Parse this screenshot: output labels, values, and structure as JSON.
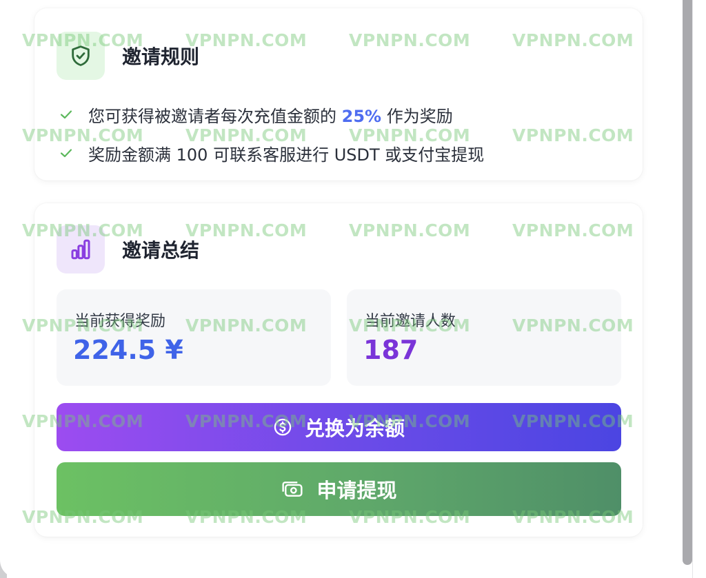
{
  "rules": {
    "title": "邀请规则",
    "items": [
      {
        "before": "您可获得被邀请者每次充值金额的 ",
        "highlight": "25%",
        "after": " 作为奖励"
      },
      {
        "before": "奖励金额满 100 可联系客服进行 USDT 或支付宝提现",
        "highlight": "",
        "after": ""
      }
    ]
  },
  "summary": {
    "title": "邀请总结",
    "reward_label": "当前获得奖励",
    "reward_value": "224.5 ¥",
    "invites_label": "当前邀请人数",
    "invites_value": "187"
  },
  "buttons": {
    "exchange_label": "兑换为余额",
    "withdraw_label": "申请提现"
  },
  "watermark": {
    "text": "VPNPN.COM"
  },
  "colors": {
    "accent_blue": "#3f63e8",
    "accent_purple": "#7a34d8",
    "exchange_gradient": [
      "#9c4cf0",
      "#4b45e2"
    ],
    "withdraw_gradient": [
      "#6cc163",
      "#4f8f68"
    ]
  },
  "icons": {
    "rules": "shield-check-icon",
    "summary": "bar-chart-icon",
    "rule_bullet": "check-icon",
    "exchange": "dollar-coin-icon",
    "withdraw": "cash-icon"
  }
}
